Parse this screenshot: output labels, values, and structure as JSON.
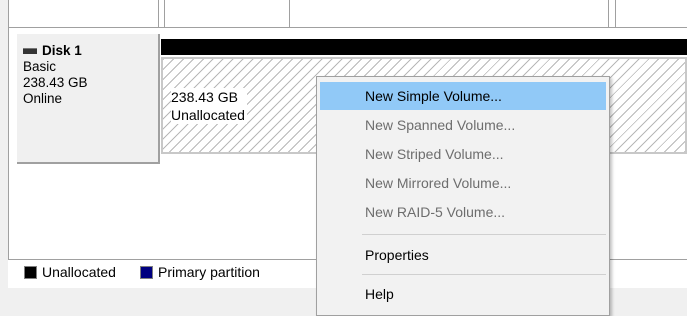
{
  "disk": {
    "name": "Disk 1",
    "type": "Basic",
    "size": "238.43 GB",
    "status": "Online"
  },
  "partition": {
    "size": "238.43 GB",
    "label": "Unallocated"
  },
  "legend": {
    "items": [
      {
        "label": "Unallocated",
        "color": "#000000"
      },
      {
        "label": "Primary partition",
        "color": "#000080"
      }
    ]
  },
  "context_menu": {
    "items": [
      {
        "label": "New Simple Volume...",
        "enabled": true,
        "highlighted": true
      },
      {
        "label": "New Spanned Volume...",
        "enabled": false
      },
      {
        "label": "New Striped Volume...",
        "enabled": false
      },
      {
        "label": "New Mirrored Volume...",
        "enabled": false
      },
      {
        "label": "New RAID-5 Volume...",
        "enabled": false
      },
      {
        "label": "Properties",
        "enabled": true
      },
      {
        "label": "Help",
        "enabled": true
      }
    ]
  },
  "colors": {
    "highlight": "#91c9f7",
    "partition_bar": "#000000",
    "disabled_text": "#6d6d6d"
  }
}
